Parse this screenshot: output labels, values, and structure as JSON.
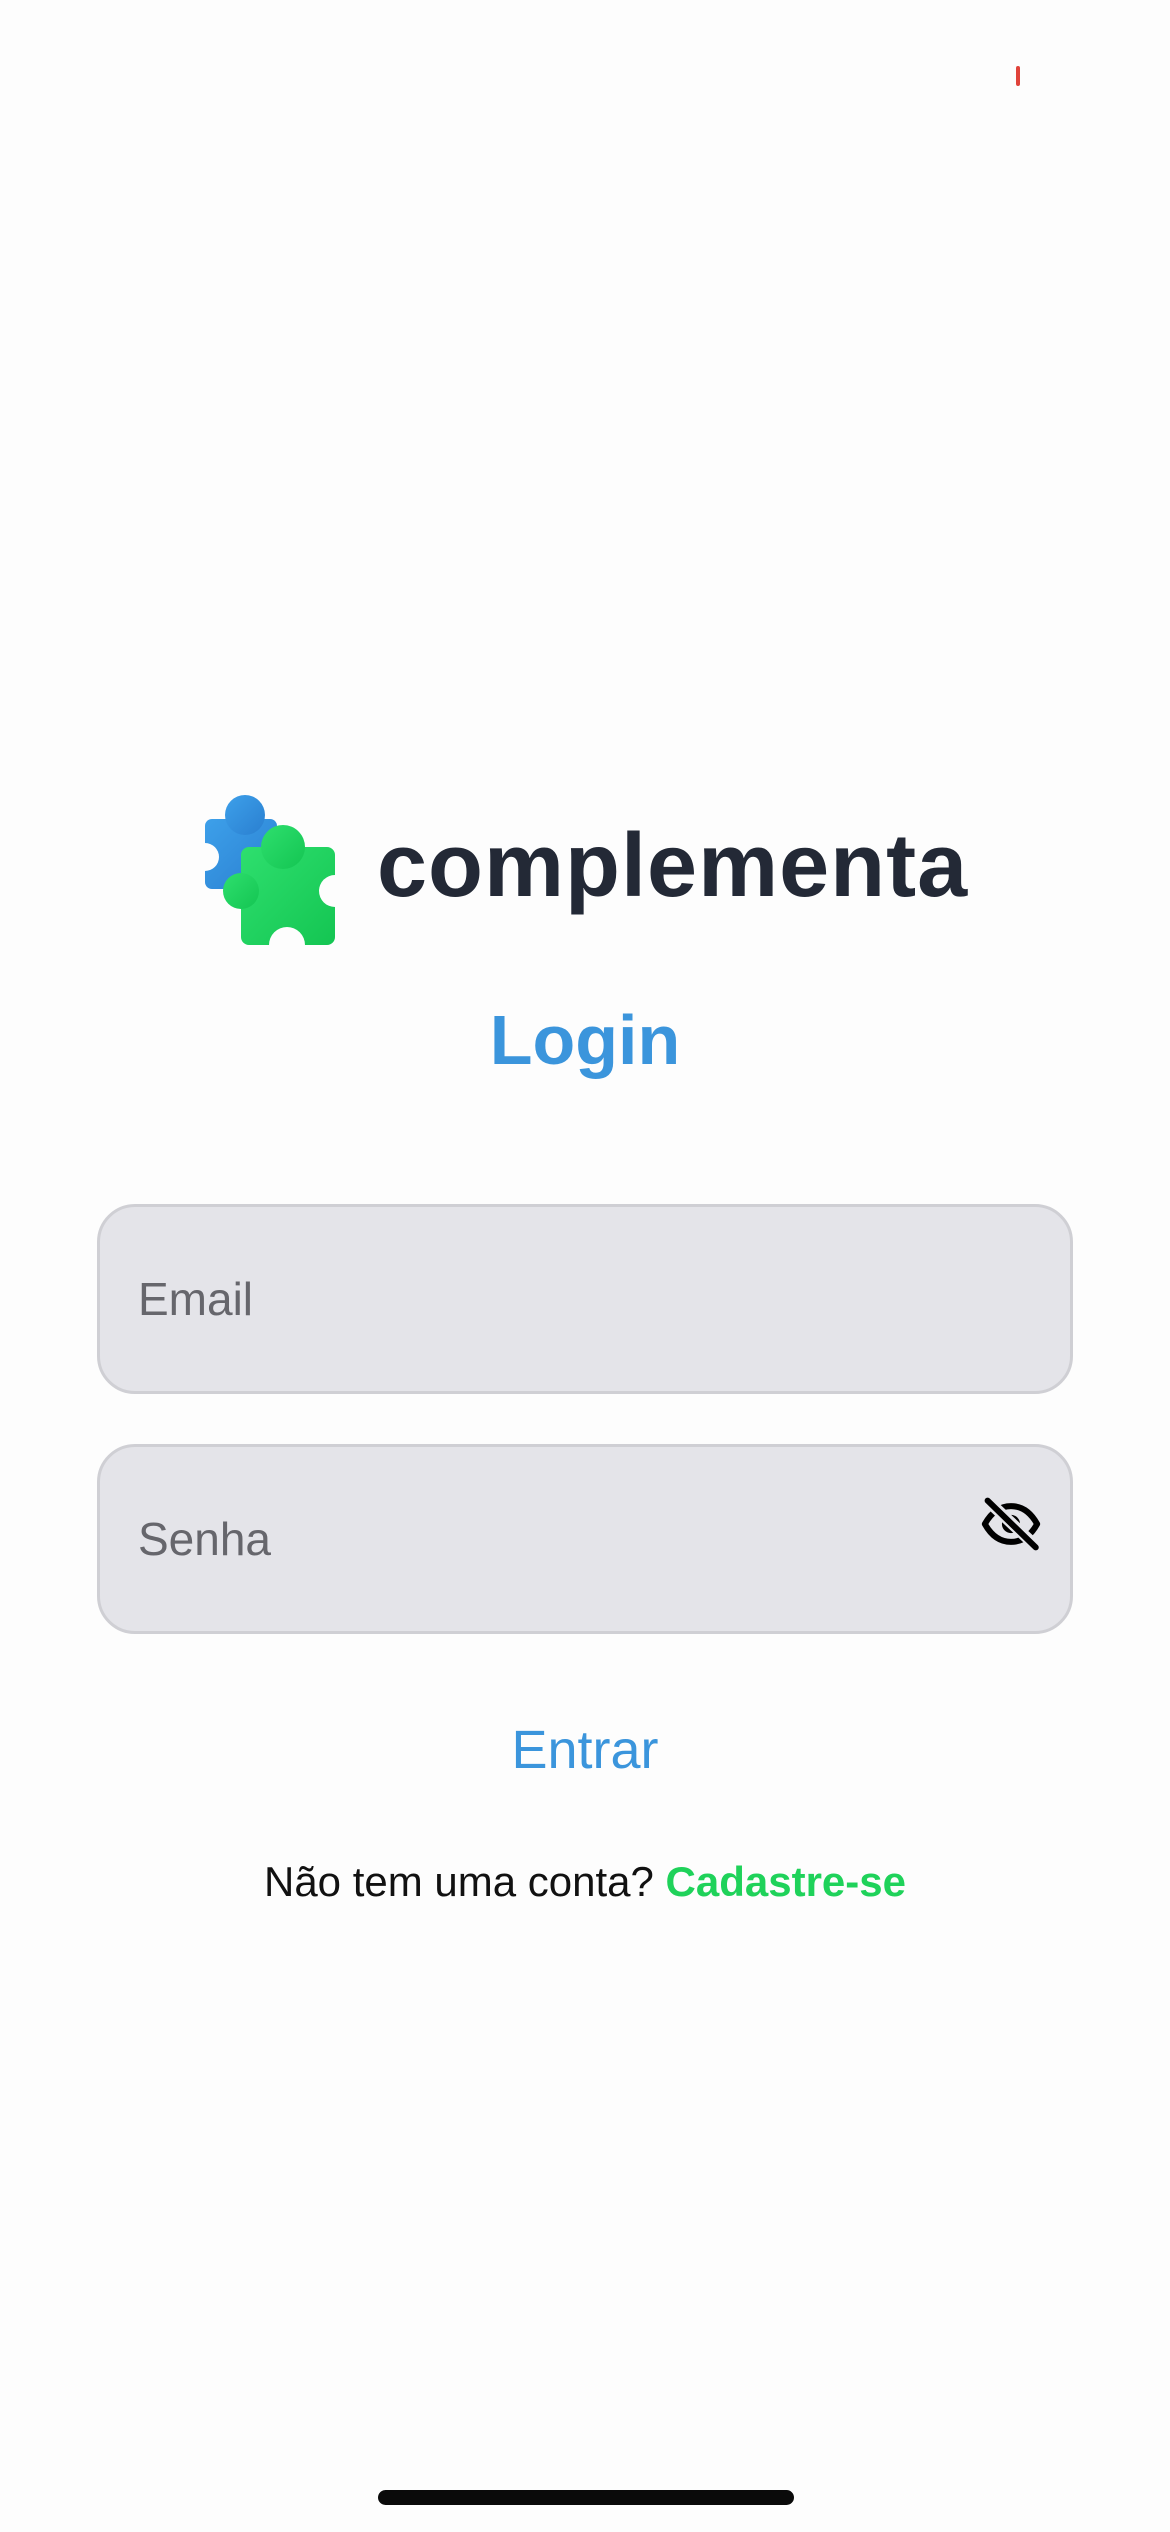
{
  "app": {
    "brand_name": "complementa",
    "logo_icon": "puzzle-pieces-icon",
    "colors": {
      "primary_blue": "#3b95dc",
      "accent_green": "#1fd25a",
      "text_dark": "#232936",
      "input_background": "#e4e4e9"
    }
  },
  "login": {
    "title": "Login",
    "email_placeholder": "Email",
    "email_value": "",
    "password_placeholder": "Senha",
    "password_value": "",
    "password_toggle_icon": "eye-off-icon",
    "submit_label": "Entrar",
    "signup_prompt": "Não tem uma conta?",
    "signup_link": "Cadastre-se"
  }
}
